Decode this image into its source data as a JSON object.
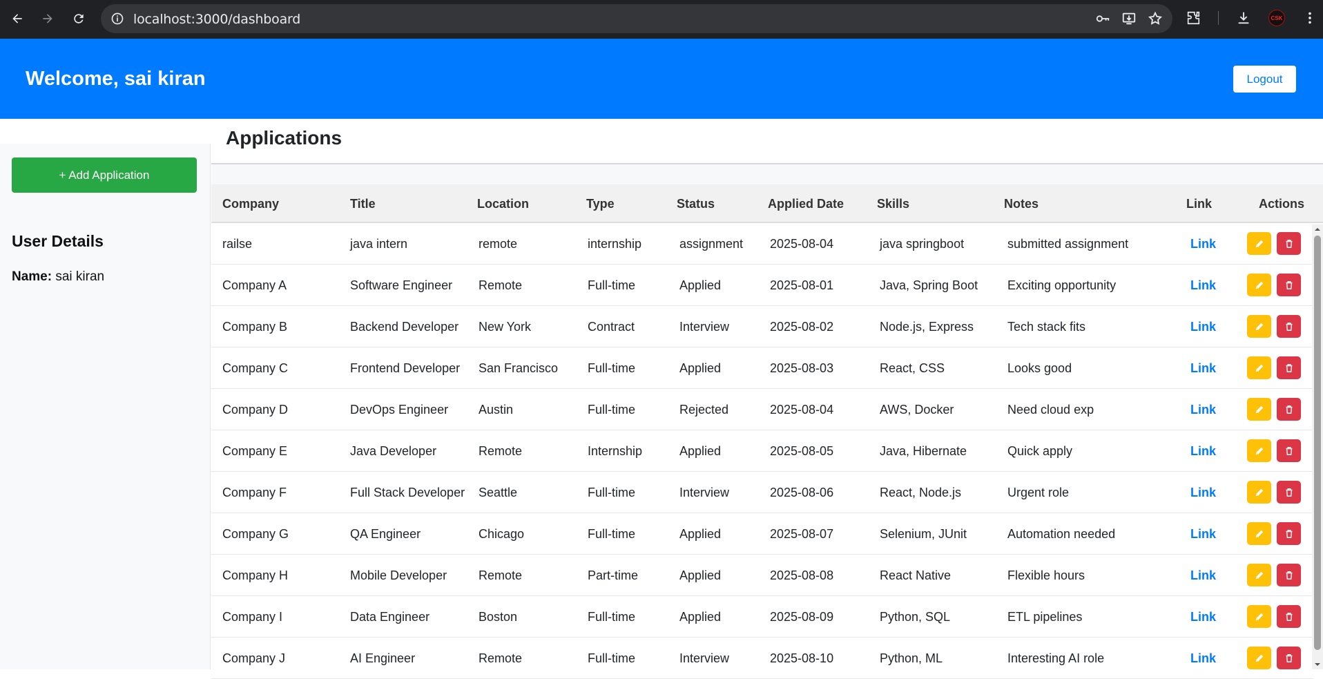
{
  "browser": {
    "url": "localhost:3000/dashboard",
    "profile_badge": "CSK"
  },
  "header": {
    "welcome": "Welcome, sai kiran",
    "logout_label": "Logout",
    "bg_color": "#007bff"
  },
  "sidebar": {
    "add_button_label": "+ Add Application",
    "user_details_title": "User Details",
    "name_label": "Name:",
    "name_value": "sai kiran"
  },
  "main": {
    "title": "Applications",
    "columns": [
      "Company",
      "Title",
      "Location",
      "Type",
      "Status",
      "Applied Date",
      "Skills",
      "Notes",
      "Link",
      "Actions"
    ],
    "rows": [
      {
        "company": "railse",
        "title": "java intern",
        "location": "remote",
        "type": "internship",
        "status": "assignment",
        "date": "2025-08-04",
        "skills": "java springboot",
        "notes": "submitted assignment",
        "link": "Link"
      },
      {
        "company": "Company A",
        "title": "Software Engineer",
        "location": "Remote",
        "type": "Full-time",
        "status": "Applied",
        "date": "2025-08-01",
        "skills": "Java, Spring Boot",
        "notes": "Exciting opportunity",
        "link": "Link"
      },
      {
        "company": "Company B",
        "title": "Backend Developer",
        "location": "New York",
        "type": "Contract",
        "status": "Interview",
        "date": "2025-08-02",
        "skills": "Node.js, Express",
        "notes": "Tech stack fits",
        "link": "Link"
      },
      {
        "company": "Company C",
        "title": "Frontend Developer",
        "location": "San Francisco",
        "type": "Full-time",
        "status": "Applied",
        "date": "2025-08-03",
        "skills": "React, CSS",
        "notes": "Looks good",
        "link": "Link"
      },
      {
        "company": "Company D",
        "title": "DevOps Engineer",
        "location": "Austin",
        "type": "Full-time",
        "status": "Rejected",
        "date": "2025-08-04",
        "skills": "AWS, Docker",
        "notes": "Need cloud exp",
        "link": "Link"
      },
      {
        "company": "Company E",
        "title": "Java Developer",
        "location": "Remote",
        "type": "Internship",
        "status": "Applied",
        "date": "2025-08-05",
        "skills": "Java, Hibernate",
        "notes": "Quick apply",
        "link": "Link"
      },
      {
        "company": "Company F",
        "title": "Full Stack Developer",
        "location": "Seattle",
        "type": "Full-time",
        "status": "Interview",
        "date": "2025-08-06",
        "skills": "React, Node.js",
        "notes": "Urgent role",
        "link": "Link"
      },
      {
        "company": "Company G",
        "title": "QA Engineer",
        "location": "Chicago",
        "type": "Full-time",
        "status": "Applied",
        "date": "2025-08-07",
        "skills": "Selenium, JUnit",
        "notes": "Automation needed",
        "link": "Link"
      },
      {
        "company": "Company H",
        "title": "Mobile Developer",
        "location": "Remote",
        "type": "Part-time",
        "status": "Applied",
        "date": "2025-08-08",
        "skills": "React Native",
        "notes": "Flexible hours",
        "link": "Link"
      },
      {
        "company": "Company I",
        "title": "Data Engineer",
        "location": "Boston",
        "type": "Full-time",
        "status": "Applied",
        "date": "2025-08-09",
        "skills": "Python, SQL",
        "notes": "ETL pipelines",
        "link": "Link"
      },
      {
        "company": "Company J",
        "title": "AI Engineer",
        "location": "Remote",
        "type": "Full-time",
        "status": "Interview",
        "date": "2025-08-10",
        "skills": "Python, ML",
        "notes": "Interesting AI role",
        "link": "Link"
      }
    ]
  },
  "icons": {
    "edit": "pencil-icon",
    "delete": "trash-icon"
  }
}
